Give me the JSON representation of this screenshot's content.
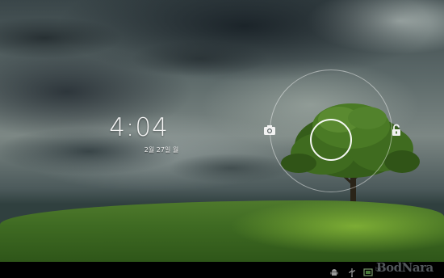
{
  "lock_screen": {
    "time": "4:04",
    "date": "2월 27일 월",
    "targets": {
      "camera_icon": "camera-icon",
      "unlock_icon": "unlock-icon"
    }
  },
  "status_bar": {
    "icons": [
      "android-debug-icon",
      "usb-icon",
      "screenshot-icon"
    ],
    "watermark": "BodNara",
    "watermark_small": "bo"
  },
  "colors": {
    "sky": "#5d6a6a",
    "grass": "#3e6a22",
    "tree": "#3f6b1f",
    "ring": "#ffffff",
    "navbar": "#000000"
  }
}
